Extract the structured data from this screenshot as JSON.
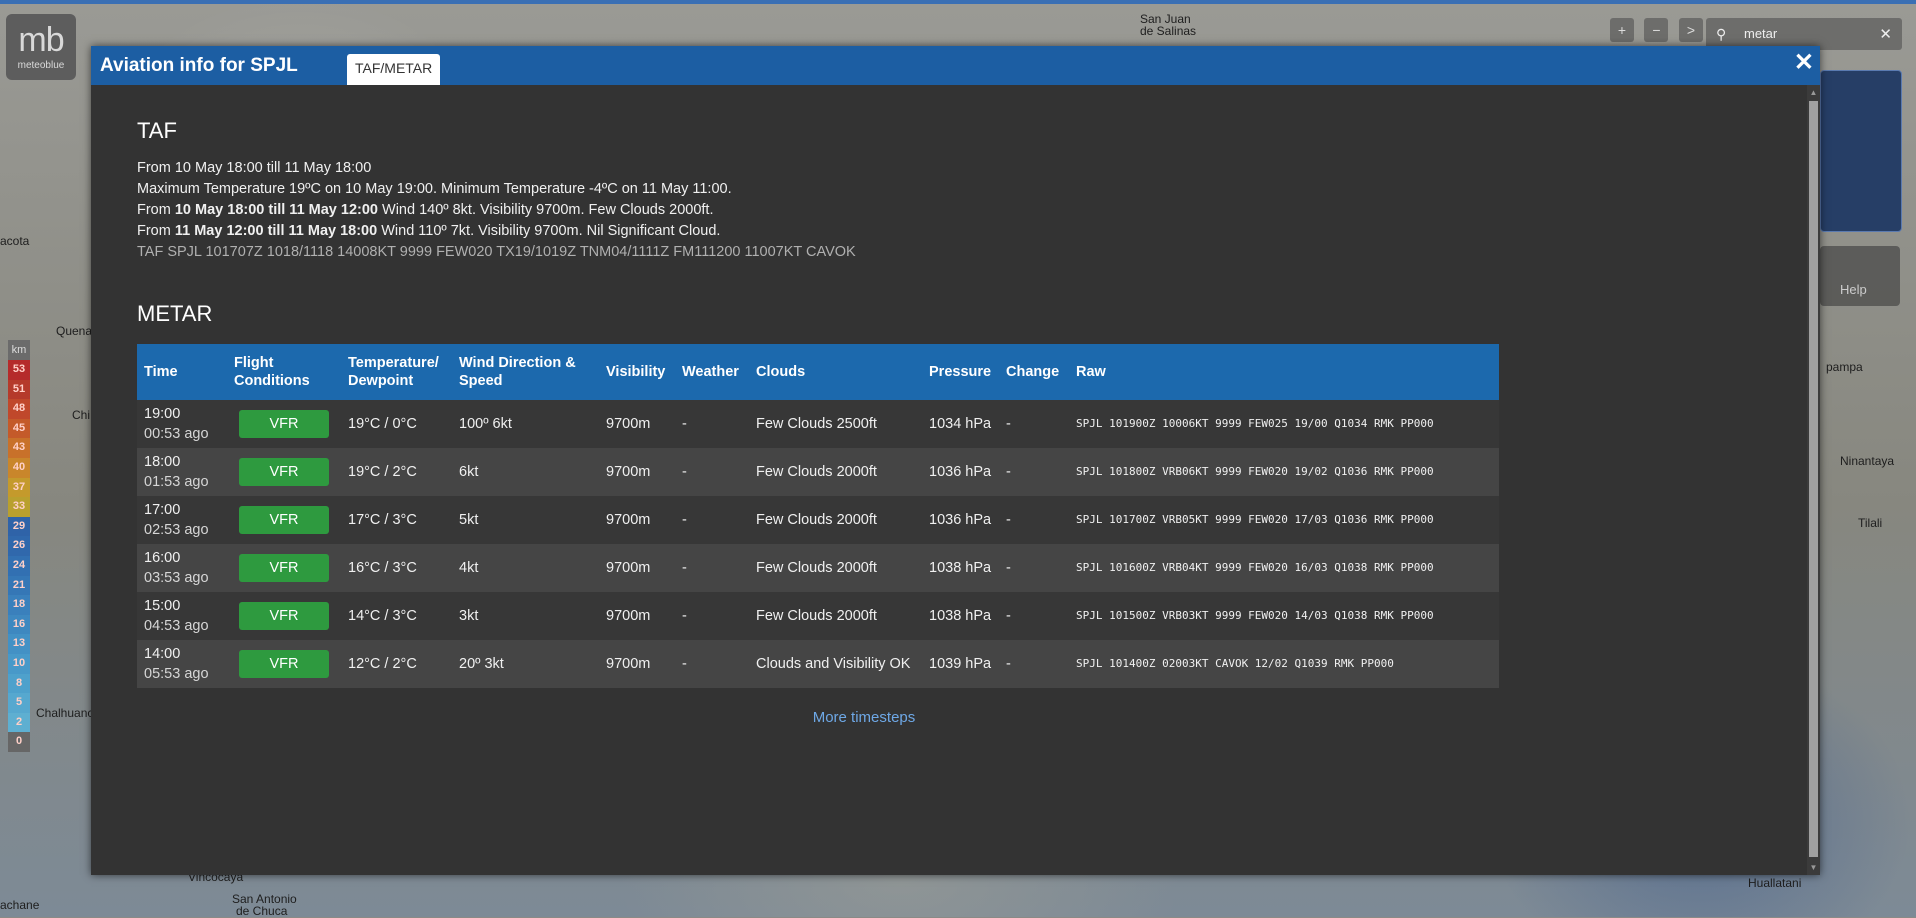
{
  "map": {
    "labels": [
      "San Juan",
      "de Salinas",
      "acota",
      "Quena",
      "Chi",
      "Chalhuanc",
      "Vincocaya",
      "San Antonio",
      "de Chuca",
      "achane",
      "Huallatani",
      "pampa",
      "Ninantaya",
      "Tilali"
    ],
    "logo_text": "mb",
    "logo_name": "meteoblue",
    "legend_unit": "km",
    "legend_values": [
      "53",
      "51",
      "48",
      "45",
      "43",
      "40",
      "37",
      "33",
      "29",
      "26",
      "24",
      "21",
      "18",
      "16",
      "13",
      "10",
      "8",
      "5",
      "2",
      "0"
    ],
    "legend_colors": [
      "#b52b2b",
      "#b53a2b",
      "#c0482b",
      "#c45a2a",
      "#c8712a",
      "#c9862b",
      "#c49a2c",
      "#b9a02e",
      "#2f63a8",
      "#3068ac",
      "#3270b2",
      "#3577b6",
      "#3a80bc",
      "#3e88c0",
      "#4391c5",
      "#4899c9",
      "#4ea1cc",
      "#56a8cf",
      "#5eafd1",
      "#666"
    ],
    "controls": [
      "+",
      "−",
      ">"
    ],
    "search_value": "metar",
    "help_label": "Help"
  },
  "modal": {
    "title": "Aviation info for SPJL",
    "tab": "TAF/METAR",
    "close": "✕"
  },
  "taf": {
    "heading": "TAF",
    "line1": "From 10 May 18:00 till 11 May 18:00",
    "line2": "Maximum Temperature 19ºC on 10 May 19:00. Minimum Temperature -4ºC on 11 May 11:00.",
    "line3_prefix": "From ",
    "line3_bold": "10 May 18:00 till 11 May 12:00",
    "line3_rest": " Wind 140º 8kt. Visibility 9700m. Few Clouds 2000ft.",
    "line4_prefix": "From ",
    "line4_bold": "11 May 12:00 till 11 May 18:00",
    "line4_rest": " Wind 110º 7kt. Visibility 9700m. Nil Significant Cloud.",
    "raw": "TAF SPJL 101707Z 1018/1118 14008KT 9999 FEW020 TX19/1019Z TNM04/1111Z FM111200 11007KT CAVOK"
  },
  "metar": {
    "heading": "METAR",
    "columns": {
      "time": "Time",
      "flight": "Flight Conditions",
      "temp": "Temperature/ Dewpoint",
      "wind": "Wind Direction & Speed",
      "visibility": "Visibility",
      "weather": "Weather",
      "clouds": "Clouds",
      "pressure": "Pressure",
      "change": "Change",
      "raw": "Raw"
    },
    "rows": [
      {
        "time": "19:00",
        "ago": "00:53 ago",
        "fc": "VFR",
        "temp": "19°C / 0°C",
        "wind": "100º 6kt",
        "vis": "9700m",
        "weather": "-",
        "clouds": "Few Clouds 2500ft",
        "pressure": "1034 hPa",
        "change": "-",
        "raw": "SPJL 101900Z 10006KT 9999 FEW025 19/00 Q1034 RMK PP000"
      },
      {
        "time": "18:00",
        "ago": "01:53 ago",
        "fc": "VFR",
        "temp": "19°C / 2°C",
        "wind": "6kt",
        "vis": "9700m",
        "weather": "-",
        "clouds": "Few Clouds 2000ft",
        "pressure": "1036 hPa",
        "change": "-",
        "raw": "SPJL 101800Z VRB06KT 9999 FEW020 19/02 Q1036 RMK PP000"
      },
      {
        "time": "17:00",
        "ago": "02:53 ago",
        "fc": "VFR",
        "temp": "17°C / 3°C",
        "wind": "5kt",
        "vis": "9700m",
        "weather": "-",
        "clouds": "Few Clouds 2000ft",
        "pressure": "1036 hPa",
        "change": "-",
        "raw": "SPJL 101700Z VRB05KT 9999 FEW020 17/03 Q1036 RMK PP000"
      },
      {
        "time": "16:00",
        "ago": "03:53 ago",
        "fc": "VFR",
        "temp": "16°C / 3°C",
        "wind": "4kt",
        "vis": "9700m",
        "weather": "-",
        "clouds": "Few Clouds 2000ft",
        "pressure": "1038 hPa",
        "change": "-",
        "raw": "SPJL 101600Z VRB04KT 9999 FEW020 16/03 Q1038 RMK PP000"
      },
      {
        "time": "15:00",
        "ago": "04:53 ago",
        "fc": "VFR",
        "temp": "14°C / 3°C",
        "wind": "3kt",
        "vis": "9700m",
        "weather": "-",
        "clouds": "Few Clouds 2000ft",
        "pressure": "1038 hPa",
        "change": "-",
        "raw": "SPJL 101500Z VRB03KT 9999 FEW020 14/03 Q1038 RMK PP000"
      },
      {
        "time": "14:00",
        "ago": "05:53 ago",
        "fc": "VFR",
        "temp": "12°C / 2°C",
        "wind": "20º 3kt",
        "vis": "9700m",
        "weather": "-",
        "clouds": "Clouds and Visibility OK",
        "pressure": "1039 hPa",
        "change": "-",
        "raw": "SPJL 101400Z 02003KT CAVOK 12/02 Q1039 RMK PP000"
      }
    ],
    "more_link": "More timesteps"
  }
}
